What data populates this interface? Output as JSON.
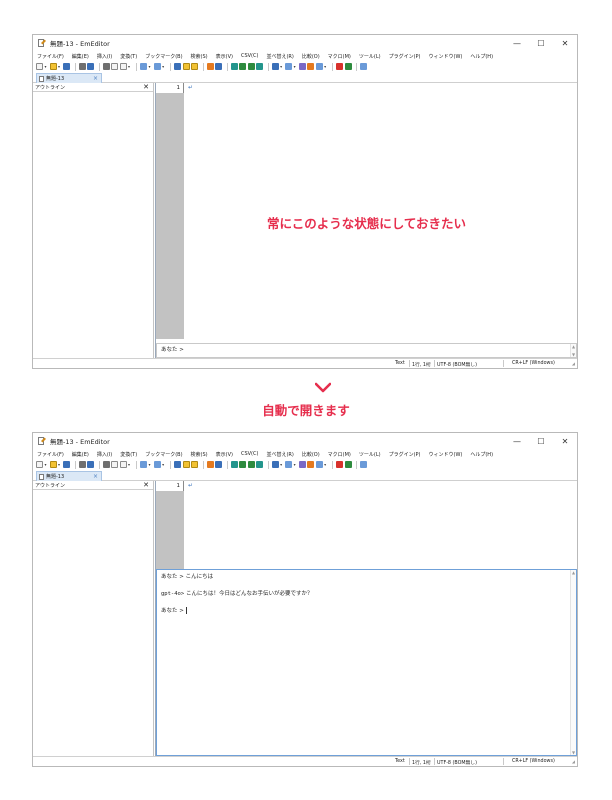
{
  "window": {
    "title": "無題-13 - EmEditor",
    "controls": [
      "—",
      "☐",
      "✕"
    ]
  },
  "menu": [
    "ファイル(F)",
    "編集(E)",
    "挿入(I)",
    "変換(T)",
    "ブックマーク(B)",
    "検索(S)",
    "表示(V)",
    "CSV(C)",
    "並べ替え(R)",
    "比較(O)",
    "マクロ(M)",
    "ツール(L)",
    "プラグイン(P)",
    "ウィンドウ(W)",
    "ヘルプ(H)"
  ],
  "tab": {
    "label": "無題-13",
    "close": "×"
  },
  "outline": {
    "title": "アウトライン",
    "close": "✕"
  },
  "editor": {
    "line_number": "1",
    "eol_mark": "↵"
  },
  "top_state": {
    "prompt": "あなた >",
    "annotation": "常にこのような状態にしておきたい"
  },
  "transition": {
    "label": "自動で開きます"
  },
  "bottom_state": {
    "chat": [
      {
        "speaker": "あなた >",
        "text": "こんにちは"
      },
      {
        "speaker": "gpt-4o>",
        "text": "こんにちは！今日はどんなお手伝いが必要ですか？"
      },
      {
        "speaker": "あなた >",
        "text": ""
      }
    ]
  },
  "statusbar": {
    "mode": "Text",
    "position": "1行, 1桁",
    "encoding": "UTF-8 (BOM無し)",
    "eol": "CR+LF (Windows)"
  },
  "colors": {
    "accent": "#e62e4d",
    "chat_border": "#6fa0d8",
    "gutter": "#c2c2c2"
  },
  "icons": [
    "new-file-icon",
    "open-folder-icon",
    "save-icon",
    "print-icon",
    "cut-icon",
    "copy-icon",
    "paste-icon",
    "undo-icon",
    "redo-icon",
    "find-icon",
    "find-next-icon",
    "find-prev-icon",
    "highlight-icon",
    "filter-icon",
    "csv-icon",
    "macro-record-icon",
    "macro-run-icon",
    "link-icon"
  ]
}
